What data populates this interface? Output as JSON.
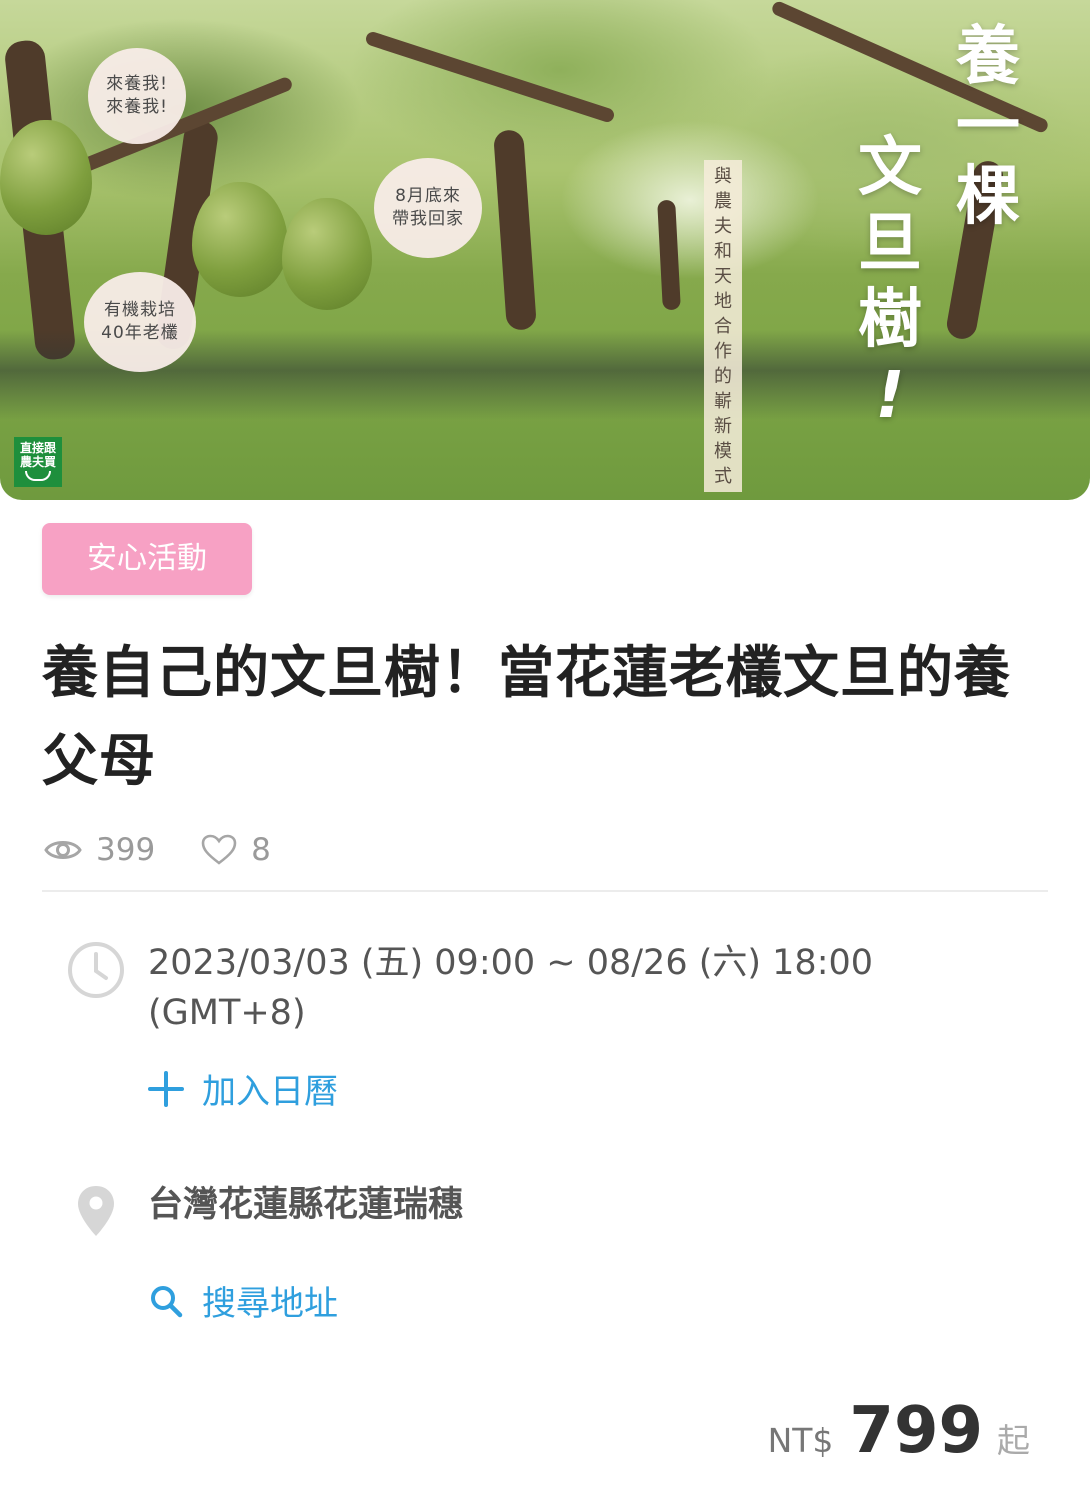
{
  "hero": {
    "bubble1": "來養我!\n來養我!",
    "bubble2": "8月底來\n帶我回家",
    "bubble3": "有機栽培\n40年老欉",
    "logo_top": "直接跟",
    "logo_bottom": "農夫買",
    "vertical_tag": "與農夫和天地合作的嶄新模式",
    "headline_col1": "養一棵",
    "headline_col2": "文旦樹",
    "headline_mark": "!"
  },
  "event": {
    "badge": "安心活動",
    "title": "養自己的文旦樹！當花蓮老欉文旦的養父母",
    "views": "399",
    "likes": "8",
    "datetime": "2023/03/03 (五) 09:00 ~ 08/26 (六) 18:00 (GMT+8)",
    "add_calendar": "加入日曆",
    "location": "台灣花蓮縣花蓮瑞穗",
    "search_address": "搜尋地址",
    "price_currency": "NT$",
    "price_amount": "799",
    "price_suffix": "起"
  },
  "colors": {
    "badge_bg": "#f7a1c4",
    "link": "#2f9fde",
    "title": "#222222"
  },
  "icons": [
    "eye-icon",
    "heart-icon",
    "clock-icon",
    "plus-icon",
    "map-pin-icon",
    "search-icon"
  ]
}
